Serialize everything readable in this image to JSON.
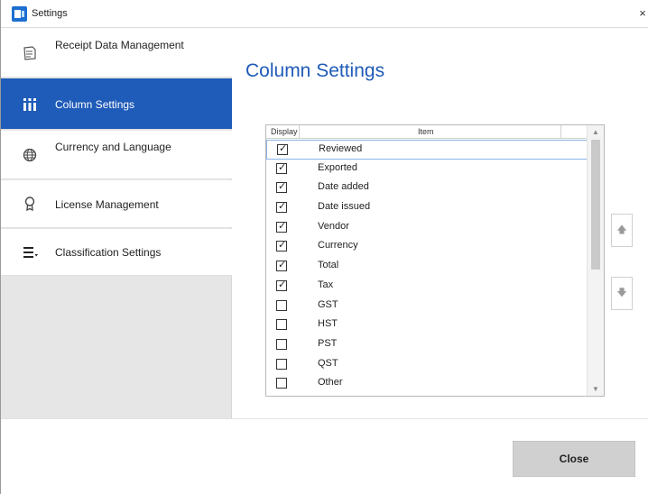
{
  "window": {
    "title": "Settings",
    "close_glyph": "×"
  },
  "sidebar": {
    "items": [
      {
        "label": "Receipt Data Management",
        "icon": "receipt-data-icon",
        "active": false
      },
      {
        "label": "Column Settings",
        "icon": "columns-icon",
        "active": true
      },
      {
        "label": "Currency and Language",
        "icon": "globe-icon",
        "active": false
      },
      {
        "label": "License Management",
        "icon": "license-icon",
        "active": false
      },
      {
        "label": "Classification Settings",
        "icon": "classification-icon",
        "active": false
      }
    ]
  },
  "main": {
    "title": "Column Settings",
    "list": {
      "headers": {
        "display": "Display",
        "item": "Item"
      },
      "rows": [
        {
          "label": "Reviewed",
          "checked": true
        },
        {
          "label": "Exported",
          "checked": true
        },
        {
          "label": "Date added",
          "checked": true
        },
        {
          "label": "Date issued",
          "checked": true
        },
        {
          "label": "Vendor",
          "checked": true
        },
        {
          "label": "Currency",
          "checked": true
        },
        {
          "label": "Total",
          "checked": true
        },
        {
          "label": "Tax",
          "checked": true
        },
        {
          "label": "GST",
          "checked": false
        },
        {
          "label": "HST",
          "checked": false
        },
        {
          "label": "PST",
          "checked": false
        },
        {
          "label": "QST",
          "checked": false
        },
        {
          "label": "Other",
          "checked": false
        }
      ],
      "selected_row": "Reviewed"
    },
    "move_up_glyph": "🡅",
    "move_down_glyph": "🡇"
  },
  "footer": {
    "close_label": "Close"
  },
  "colors": {
    "accent": "#1f5bb8",
    "sidebar_bg": "#e6e6e6",
    "button_bg": "#d0d0d0"
  }
}
